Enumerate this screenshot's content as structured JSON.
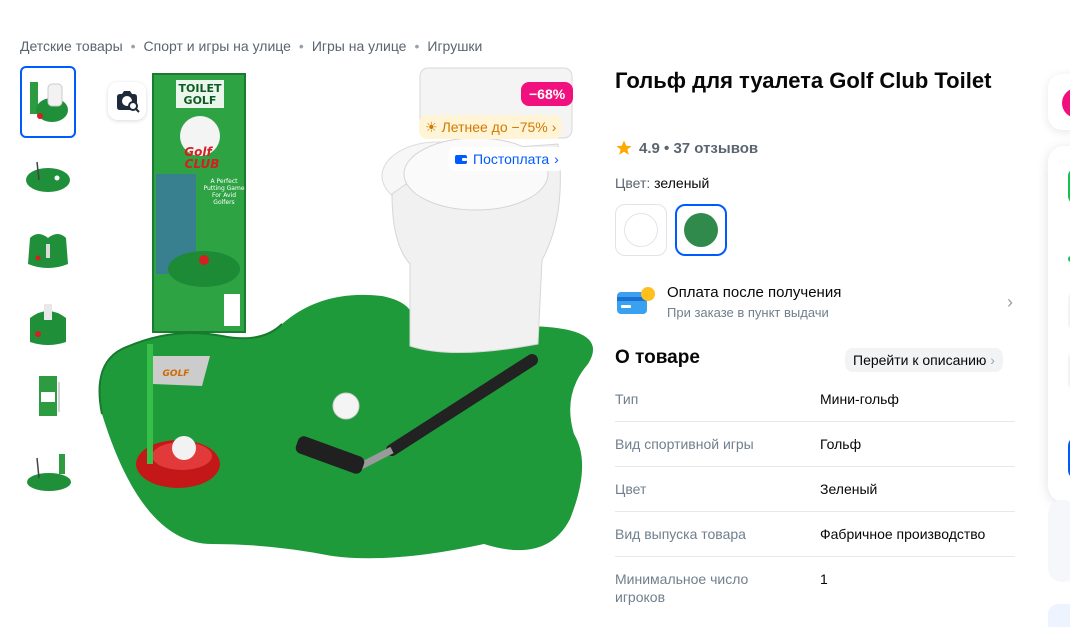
{
  "breadcrumb": [
    "Детские товары",
    "Спорт и игры на улице",
    "Игры на улице",
    "Игрушки"
  ],
  "product": {
    "title": "Гольф для туалета Golf Club Toilet",
    "rating": "4.9 • 37 отзывов",
    "color_label": "Цвет:",
    "color_value": "зеленый",
    "colors": [
      "#ffffff",
      "#2f8a4b"
    ]
  },
  "gallery": {
    "badge_discount": "−68%",
    "badge_summer": "Летнее до −75%",
    "badge_postpay": "Постоплата",
    "box_title_line1": "TOILET",
    "box_title_line2": "GOLF",
    "box_logo_line1": "Golf",
    "box_logo_line2": "CLUB",
    "box_caption": "A Perfect Putting Game For Avid Golfers"
  },
  "payment": {
    "title": "Оплата после получения",
    "subtitle": "При заказе в пункт выдачи"
  },
  "about": {
    "heading": "О товаре",
    "to_description": "Перейти к описанию"
  },
  "specs": [
    {
      "key": "Тип",
      "value": "Мини-гольф"
    },
    {
      "key": "Вид спортивной игры",
      "value": "Гольф"
    },
    {
      "key": "Цвет",
      "value": "Зеленый"
    },
    {
      "key": "Вид выпуска товара",
      "value": "Фабричное производство"
    },
    {
      "key": "Минимальное число игроков",
      "value": "1"
    }
  ],
  "colors": {
    "accent": "#005bff",
    "discount": "#f1117e",
    "summer": "#d07a00",
    "star": "#ffa800"
  }
}
